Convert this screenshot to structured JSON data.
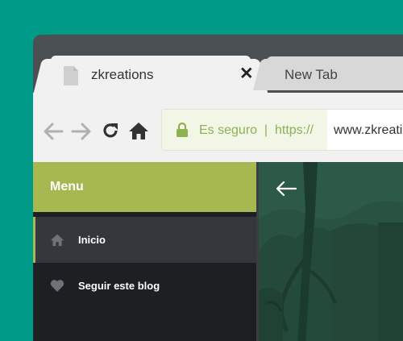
{
  "browser": {
    "tabs": [
      {
        "title": "zkreations",
        "active": true,
        "icon": "file-icon",
        "close_icon": "✕"
      },
      {
        "title": "New Tab",
        "active": false
      }
    ],
    "toolbar": {
      "back_icon": "arrow-left-icon",
      "forward_icon": "arrow-right-icon",
      "reload_icon": "reload-icon",
      "home_icon": "home-icon"
    },
    "address_bar": {
      "lock_icon": "lock-icon",
      "security_text": "Es seguro  |  https://",
      "url": "www.zkreations.com"
    }
  },
  "sidebar": {
    "title": "Menu",
    "items": [
      {
        "label": "Inicio",
        "icon": "home-icon",
        "active": true
      },
      {
        "label": "Seguir este blog",
        "icon": "heart-icon",
        "active": false
      }
    ]
  },
  "hero": {
    "back_icon": "arrow-left-icon"
  },
  "colors": {
    "background": "#009a88",
    "accent": "#a6b84f",
    "secure_text": "#8db153",
    "menu_bg": "#1d1f23",
    "menu_active_bg": "#34373c"
  }
}
